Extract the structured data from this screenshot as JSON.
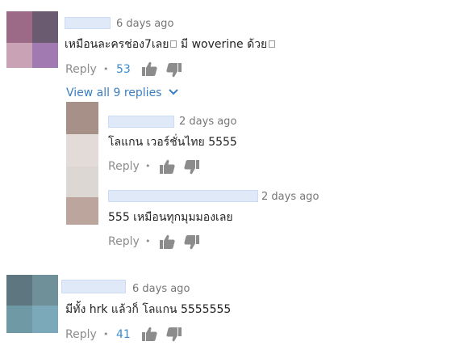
{
  "comments": [
    {
      "timestamp": "6 days ago",
      "text": "เหมือนละครช่อง7เลย",
      "text2": " มี woverine ด้วย",
      "reply_label": "Reply",
      "likes": "53",
      "avatar_colors": [
        "#9c6a87",
        "#6b5b70",
        "#c9a3b5",
        "#a07ab0"
      ]
    },
    {
      "timestamp": "6 days ago",
      "text": "มีทั้ง hrk แล้วก็ โลแกน 5555555",
      "reply_label": "Reply",
      "likes": "41",
      "avatar_colors": [
        "#5d7680",
        "#6f8f99",
        "#6f9aa5",
        "#7ba9b9"
      ]
    }
  ],
  "view_replies": {
    "label": "View all 9 replies"
  },
  "replies": [
    {
      "timestamp": "2 days ago",
      "text": "โลแกน เวอร์ชั่นไทย 5555",
      "reply_label": "Reply"
    },
    {
      "timestamp": "2 days ago",
      "text": "555 เหมือนทุกมุมมองเลย",
      "reply_label": "Reply"
    }
  ],
  "reply_avatar_colors": [
    "#a69088",
    "#e2dbd8",
    "#ddd7d4",
    "#bba59d"
  ],
  "separator": "•"
}
